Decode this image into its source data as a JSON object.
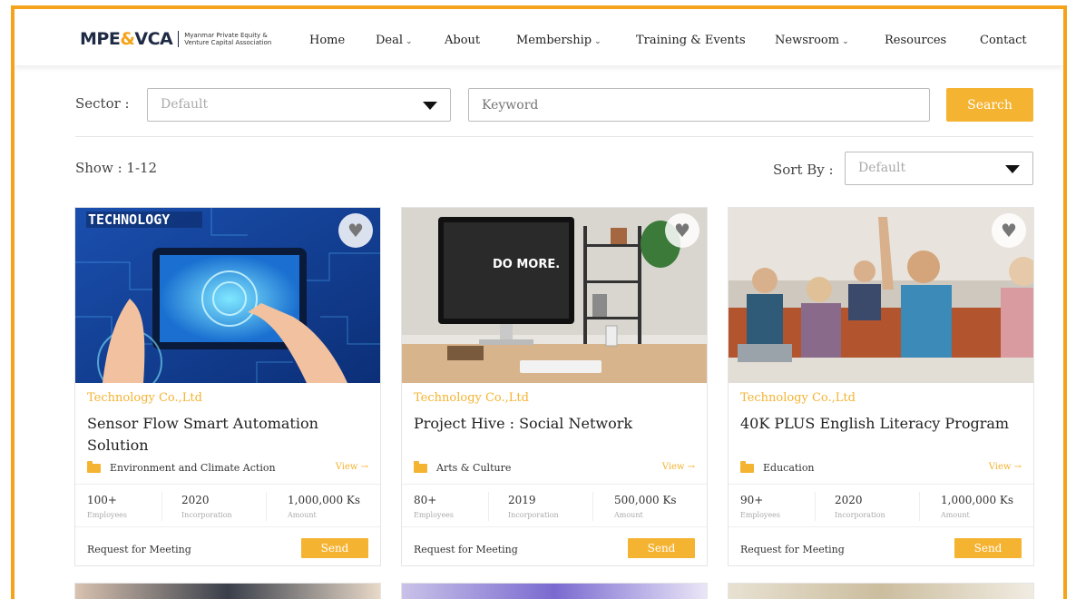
{
  "brand": {
    "logo_main": "MPE",
    "logo_amp": "&",
    "logo_end": "VCA",
    "logo_subtitle": "Myanmar Private Equity & Venture Capital Association",
    "accent_color": "#f5b332",
    "frame_color": "#f5a31a"
  },
  "nav": {
    "items": [
      {
        "label": "Home",
        "dropdown": false
      },
      {
        "label": "Deal",
        "dropdown": true
      },
      {
        "label": "About",
        "dropdown": false
      },
      {
        "label": "Membership",
        "dropdown": true
      },
      {
        "label": "Training & Events",
        "dropdown": false
      },
      {
        "label": "Newsroom",
        "dropdown": true
      },
      {
        "label": "Resources",
        "dropdown": false
      },
      {
        "label": "Contact",
        "dropdown": false
      }
    ]
  },
  "filters": {
    "sector_label": "Sector :",
    "sector_value": "Default",
    "keyword_placeholder": "Keyword",
    "search_label": "Search",
    "show_text": "Show : 1-12",
    "sort_label": "Sort By :",
    "sort_value": "Default"
  },
  "cards": [
    {
      "image": "technology-tablet-illustration",
      "image_caption": "TECHNOLOGY",
      "company": "Technology Co.,Ltd",
      "title": "Sensor Flow Smart Automation Solution",
      "category": "Environment and Climate Action",
      "view_label": "View →",
      "stats": [
        {
          "value": "100+",
          "label": "Employees"
        },
        {
          "value": "2020",
          "label": "Incorporation"
        },
        {
          "value": "1,000,000 Ks",
          "label": "Amount"
        }
      ],
      "request_label": "Request for Meeting",
      "send_label": "Send"
    },
    {
      "image": "desk-computer-do-more",
      "image_caption": "DO MORE.",
      "company": "Technology Co.,Ltd",
      "title": "Project Hive : Social Network",
      "category": "Arts & Culture",
      "view_label": "View →",
      "stats": [
        {
          "value": "80+",
          "label": "Employees"
        },
        {
          "value": "2019",
          "label": "Incorporation"
        },
        {
          "value": "500,000 Ks",
          "label": "Amount"
        }
      ],
      "request_label": "Request for Meeting",
      "send_label": "Send"
    },
    {
      "image": "students-classroom",
      "image_caption": "",
      "company": "Technology Co.,Ltd",
      "title": "40K PLUS English Literacy Program",
      "category": "Education",
      "view_label": "View →",
      "stats": [
        {
          "value": "90+",
          "label": "Employees"
        },
        {
          "value": "2020",
          "label": "Incorporation"
        },
        {
          "value": "1,000,000 Ks",
          "label": "Amount"
        }
      ],
      "request_label": "Request for Meeting",
      "send_label": "Send"
    }
  ]
}
